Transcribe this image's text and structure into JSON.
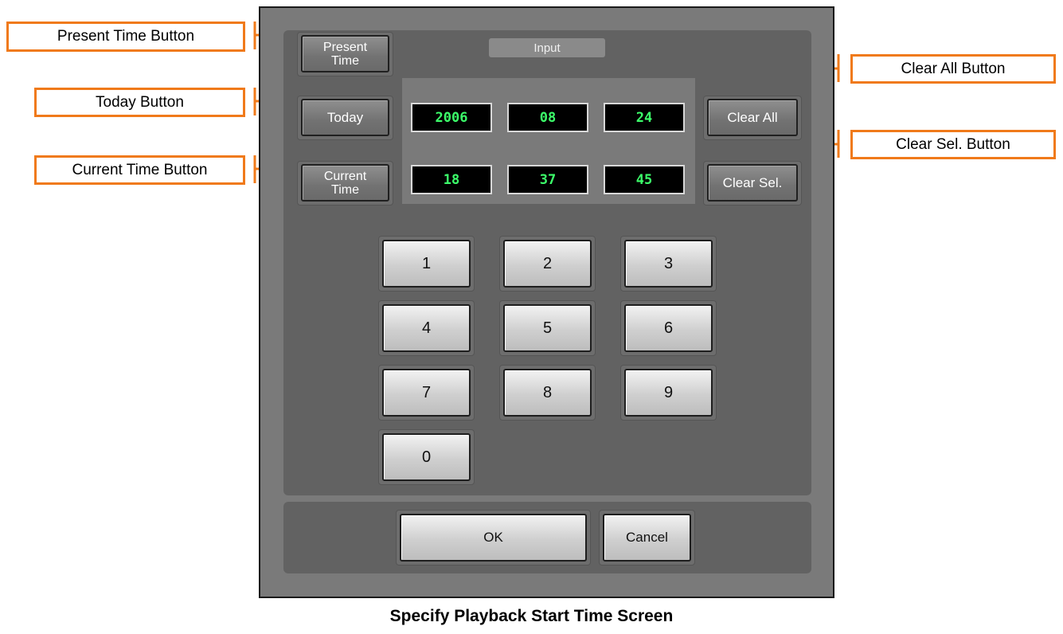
{
  "callouts": {
    "present_time": "Present Time Button",
    "today": "Today Button",
    "current_time": "Current Time Button",
    "clear_all": "Clear All Button",
    "clear_sel": "Clear Sel. Button"
  },
  "dialog": {
    "input_label": "Input",
    "left_buttons": {
      "present_time_line1": "Present",
      "present_time_line2": "Time",
      "today": "Today",
      "current_time_line1": "Current",
      "current_time_line2": "Time"
    },
    "right_buttons": {
      "clear_all": "Clear All",
      "clear_sel": "Clear Sel."
    },
    "date": {
      "year": "2006",
      "month": "08",
      "day": "24"
    },
    "time": {
      "hour": "18",
      "minute": "37",
      "second": "45"
    },
    "keypad": [
      "1",
      "2",
      "3",
      "4",
      "5",
      "6",
      "7",
      "8",
      "9",
      "0"
    ],
    "ok": "OK",
    "cancel": "Cancel"
  },
  "caption": "Specify Playback Start Time Screen",
  "colors": {
    "callout_border": "#f07a1a",
    "digit_text": "#3cff6a"
  }
}
